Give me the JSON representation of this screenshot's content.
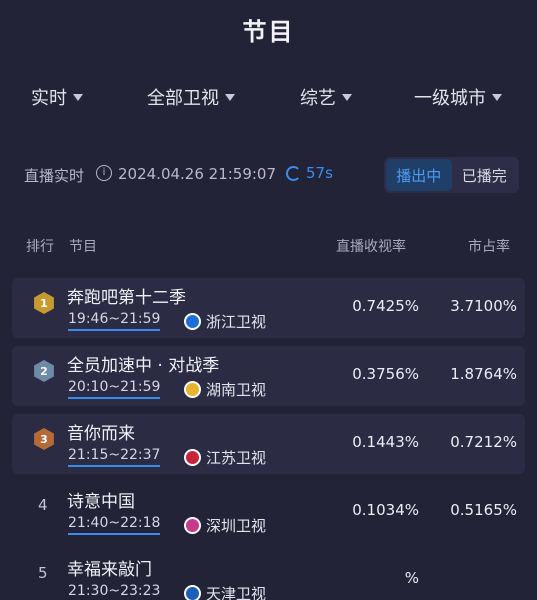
{
  "header": {
    "title": "节目"
  },
  "filters": [
    {
      "label": "实时"
    },
    {
      "label": "全部卫视"
    },
    {
      "label": "综艺"
    },
    {
      "label": "一级城市"
    }
  ],
  "status": {
    "live_label": "直播实时",
    "timestamp": "2024.04.26 21:59:07",
    "refresh_seconds": "57s",
    "toggle": [
      {
        "label": "播出中",
        "active": true
      },
      {
        "label": "已播完",
        "active": false
      }
    ]
  },
  "table": {
    "columns": {
      "rank": "排行",
      "program": "节目",
      "rating": "直播收视率",
      "share": "市占率"
    },
    "rows": [
      {
        "rank": "1",
        "name": "奔跑吧第十二季",
        "time": "19:46~21:59",
        "channel": "浙江卫视",
        "logo_color": "#1b6fd6",
        "rating": "0.7425%",
        "share": "3.7100%",
        "medal": "#c79a2e"
      },
      {
        "rank": "2",
        "name": "全员加速中 · 对战季",
        "time": "20:10~21:59",
        "channel": "湖南卫视",
        "logo_color": "#e8b52a",
        "rating": "0.3756%",
        "share": "1.8764%",
        "medal": "#6f8aa6"
      },
      {
        "rank": "3",
        "name": "音你而来",
        "time": "21:15~22:37",
        "channel": "江苏卫视",
        "logo_color": "#c8253a",
        "rating": "0.1443%",
        "share": "0.7212%",
        "medal": "#b36a36"
      },
      {
        "rank": "4",
        "name": "诗意中国",
        "time": "21:40~22:18",
        "channel": "深圳卫视",
        "logo_color": "#c63a8c",
        "rating": "0.1034%",
        "share": "0.5165%"
      },
      {
        "rank": "5",
        "name": "幸福来敲门",
        "time": "21:30~23:23",
        "channel": "天津卫视",
        "logo_color": "#1c5fb8",
        "rating": "%",
        "share": ""
      }
    ]
  }
}
